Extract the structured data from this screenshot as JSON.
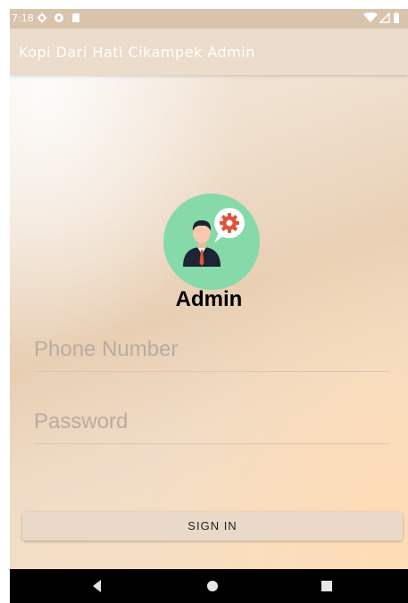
{
  "status_bar": {
    "time": "7:18",
    "left_icons": [
      "settings-icon",
      "shield-icon",
      "sd-card-icon"
    ],
    "right_icons": [
      "wifi-icon",
      "signal-icon",
      "battery-icon"
    ]
  },
  "app_bar": {
    "title": "Kopi Dari Hati Cikampek Admin"
  },
  "login": {
    "avatar_icon": "admin-avatar-icon",
    "heading": "Admin",
    "phone_placeholder": "Phone Number",
    "password_placeholder": "Password",
    "sign_in_label": "SIGN IN"
  },
  "nav_bar": {
    "buttons": [
      "back-icon",
      "home-icon",
      "recents-icon"
    ]
  },
  "colors": {
    "accent_green": "#86d9a8",
    "gear_red": "#e0533b",
    "status_bar": "#d8c3ac",
    "app_bar": "#ecdccb"
  }
}
